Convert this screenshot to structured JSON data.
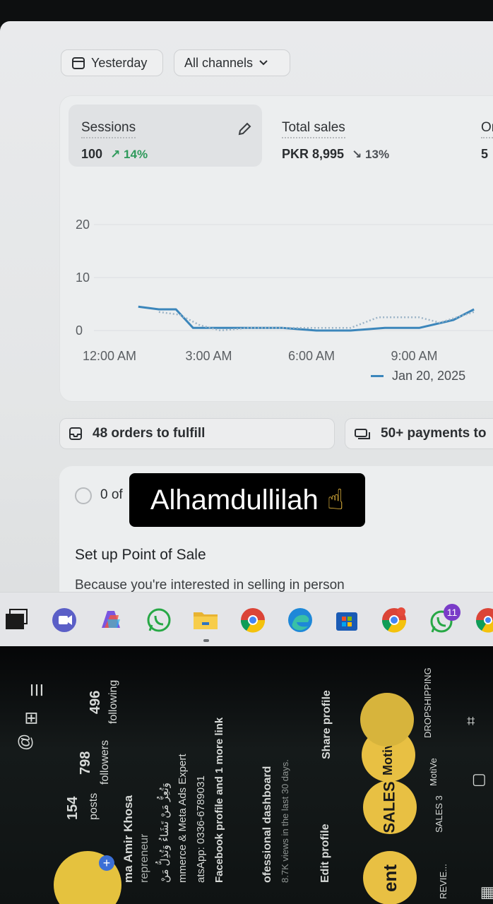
{
  "filters": {
    "date": "Yesterday",
    "channel": "All channels"
  },
  "metrics": {
    "sessions": {
      "label": "Sessions",
      "value": "100",
      "change": "14%"
    },
    "sales": {
      "label": "Total sales",
      "value": "PKR 8,995",
      "change": "13%"
    },
    "orders": {
      "label": "Or",
      "value": "5"
    }
  },
  "chart_data": {
    "type": "line",
    "x_tick_labels": [
      "12:00 AM",
      "3:00 AM",
      "6:00 AM",
      "9:00 AM"
    ],
    "y_tick_labels": [
      "20",
      "10",
      "0"
    ],
    "ylim": [
      0,
      20
    ],
    "series": [
      {
        "name": "Jan 20, 2025",
        "style": "solid",
        "x_hours": [
          0.8,
          1.4,
          1.9,
          2.4,
          3.0,
          4.0,
          5.0,
          6.0,
          7.0,
          8.0,
          9.0,
          10.0,
          10.6
        ],
        "values": [
          4.5,
          4.0,
          4.0,
          0.5,
          0.5,
          0.5,
          0.5,
          0.0,
          0.0,
          0.5,
          0.5,
          2.0,
          4.0
        ]
      },
      {
        "name": "",
        "style": "dotted",
        "x_hours": [
          1.4,
          2.0,
          2.6,
          3.2,
          4.0,
          5.0,
          6.0,
          7.0,
          7.8,
          8.4,
          9.0,
          9.6,
          10.6
        ],
        "values": [
          3.5,
          3.0,
          1.0,
          0.0,
          0.5,
          0.5,
          0.5,
          0.5,
          2.5,
          2.5,
          2.5,
          1.5,
          3.5
        ]
      }
    ],
    "grid": true,
    "legend_position": "bottom-right"
  },
  "tasks": {
    "fulfill": "48 orders to fulfill",
    "payments": "50+ payments to"
  },
  "setup": {
    "progress": "0 of",
    "title": "Set up Point of Sale",
    "description": "Because you're interested in selling in person"
  },
  "caption": {
    "text": "Alhamdullilah",
    "emoji": "☝"
  },
  "taskbar": {
    "icons": [
      "task-view-icon",
      "teams-icon",
      "copilot-icon",
      "whatsapp-icon",
      "file-explorer-icon",
      "chrome-icon",
      "edge-icon",
      "store-icon",
      "chrome-profile-icon",
      "whatsapp-icon",
      "chrome-icon"
    ],
    "whatsapp_badge": "11"
  },
  "instagram": {
    "posts_count": "154",
    "posts_label": "posts",
    "followers_count": "798",
    "followers_label": "followers",
    "following_count": "496",
    "following_label": "following",
    "name": "ma Amir Khosa",
    "role": "repreneur",
    "arabic_line": "وَتُعِزُّ مَنْ تَشَاءُ وَتُذِلُّ مَنْ",
    "bio_line": "mmerce & Meta Ads Expert",
    "whatsapp_line": "atsApp: 0336-6789031",
    "links_line": "Facebook profile and 1 more link",
    "dashboard_title": "ofessional dashboard",
    "dashboard_sub": "8.7K views in the last 30 days.",
    "edit_profile": "Edit profile",
    "share_profile": "Share profile",
    "highlights": [
      {
        "label": "REVIE...",
        "bubble": "ent"
      },
      {
        "label": "SALES 3",
        "bubble": "SALES"
      },
      {
        "label": "MotiVe",
        "bubble": "Motive"
      },
      {
        "label": "DROPSHIPPING",
        "bubble": ""
      }
    ]
  }
}
